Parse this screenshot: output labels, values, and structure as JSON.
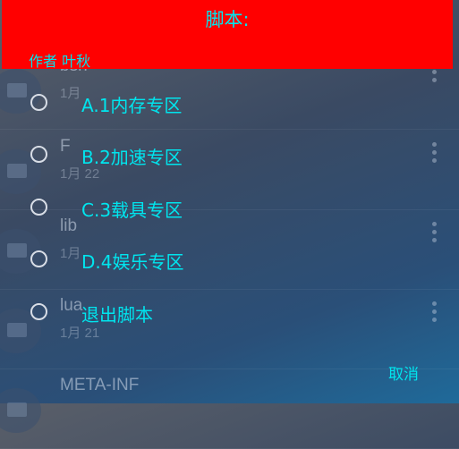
{
  "background": {
    "rows": [
      {
        "name": "bsh",
        "date": "1月"
      },
      {
        "name": "F",
        "date": "1月 22"
      },
      {
        "name": "lib",
        "date": "1月"
      },
      {
        "name": "lua",
        "date": "1月 21"
      },
      {
        "name": "META-INF",
        "date": ""
      }
    ]
  },
  "dialog": {
    "title": "脚本:",
    "author": "作者 叶秋",
    "title_bg_color": "#ff0000",
    "text_color": "#00e5ee",
    "options": [
      {
        "label": "A.1内存专区",
        "selected": false
      },
      {
        "label": "B.2加速专区",
        "selected": false
      },
      {
        "label": "C.3载具专区",
        "selected": false
      },
      {
        "label": "D.4娱乐专区",
        "selected": false
      },
      {
        "label": "退出脚本",
        "selected": false
      }
    ],
    "cancel_label": "取消"
  }
}
